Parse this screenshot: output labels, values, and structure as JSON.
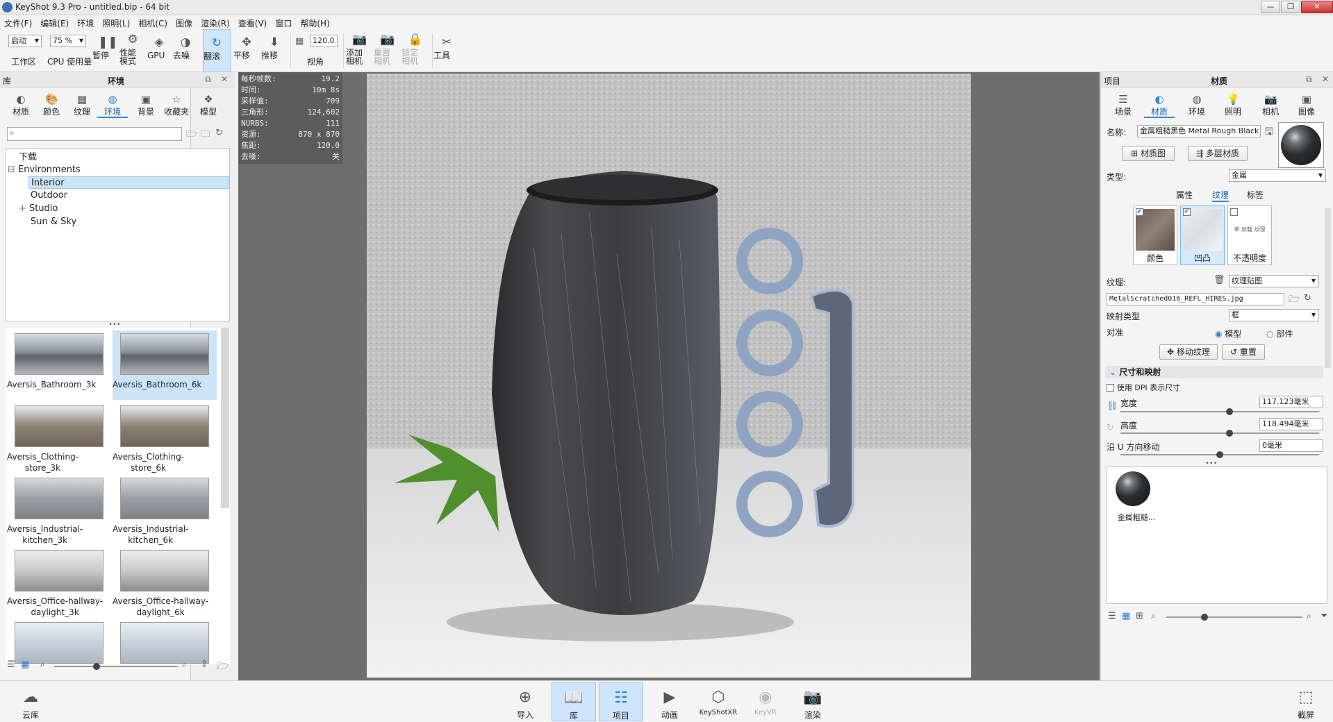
{
  "window": {
    "title": "KeyShot 9.3 Pro  - untitled.bip  - 64 bit"
  },
  "menu": [
    "文件(F)",
    "编辑(E)",
    "环境",
    "照明(L)",
    "相机(C)",
    "图像",
    "渲染(R)",
    "查看(V)",
    "窗口",
    "帮助(H)"
  ],
  "toolbar": {
    "workspace_value": "启动",
    "workspace_label": "工作区",
    "cpu_value": "75 %",
    "cpu_label": "CPU 使用量",
    "pause": "暂停",
    "perf_mode": "性能\n模式",
    "gpu": "GPU",
    "denoise": "去噪",
    "tumble": "翻滚",
    "pan": "平移",
    "dolly": "推移",
    "fov_value": "120.0",
    "fov_label": "视角",
    "add_camera": "添加\n相机",
    "reset_camera": "重置\n相机",
    "lock_camera": "锁定\n相机",
    "tools": "工具"
  },
  "library": {
    "header_left": "库",
    "header_title": "环境",
    "tabs": [
      "材质",
      "颜色",
      "纹理",
      "环境",
      "背景",
      "收藏夹",
      "模型"
    ],
    "active_tab": "环境",
    "tree": {
      "downloads": "下载",
      "root": "Environments",
      "children": [
        "Interior",
        "Outdoor",
        "Studio",
        "Sun & Sky"
      ],
      "selected": "Interior"
    },
    "thumbnails": [
      {
        "label": "Aversis_Bathroom_3k"
      },
      {
        "label": "Aversis_Bathroom_6k"
      },
      {
        "label": "Aversis_Clothing-\nstore_3k"
      },
      {
        "label": "Aversis_Clothing-\nstore_6k"
      },
      {
        "label": "Aversis_Industrial-\nkitchen_3k"
      },
      {
        "label": "Aversis_Industrial-\nkitchen_6k"
      },
      {
        "label": "Aversis_Office-hallway-\ndaylight_3k"
      },
      {
        "label": "Aversis_Office-hallway-\ndaylight_6k"
      },
      {
        "label": ""
      },
      {
        "label": ""
      }
    ],
    "selected_thumbnail": "Aversis_Bathroom_6k"
  },
  "hud": [
    {
      "k": "每秒帧数:",
      "v": "19.2"
    },
    {
      "k": "时间:",
      "v": "10m 8s"
    },
    {
      "k": "采样值:",
      "v": "709"
    },
    {
      "k": "三角形:",
      "v": "124,602"
    },
    {
      "k": "NURBS:",
      "v": "111"
    },
    {
      "k": "资源:",
      "v": "870 x 870"
    },
    {
      "k": "焦距:",
      "v": "120.0"
    },
    {
      "k": "去噪:",
      "v": "关"
    }
  ],
  "project": {
    "header_left": "项目",
    "header_title": "材质",
    "tabs": [
      "场景",
      "材质",
      "环境",
      "照明",
      "相机",
      "图像"
    ],
    "active_tab": "材质",
    "name_label": "名称:",
    "name_value": "金属粗糙黑色 Metal Rough Black",
    "material_graph": "材质图",
    "multilayer": "多层材质",
    "type_label": "类型:",
    "type_value": "金属",
    "subtabs": [
      "属性",
      "纹理",
      "标签"
    ],
    "active_subtab": "纹理",
    "tex_cards": [
      {
        "label": "颜色",
        "checked": true
      },
      {
        "label": "凹凸",
        "checked": true
      },
      {
        "label": "不透明度",
        "checked": false,
        "hint": "单 加载 纹理"
      }
    ],
    "texture_label": "纹理:",
    "texture_type": "纹理贴图",
    "texture_file": "MetalScratched016_REFL_HIRES.jpg",
    "mapping_label": "映射类型",
    "mapping_value": "框",
    "align_label": "对准",
    "align_model": "模型",
    "align_part": "部件",
    "move_texture": "移动纹理",
    "reset": "重置",
    "size_section": "尺寸和映射",
    "dpi_label": "使用 DPI 表示尺寸",
    "width_label": "宽度",
    "width_value": "117.123毫米",
    "width_slider": 0.55,
    "height_label": "高度",
    "height_value": "118.494毫米",
    "height_slider": 0.55,
    "u_label": "沿 U 方向移动",
    "u_value": "0毫米",
    "u_slider": 0.5,
    "swatch_label": "金属粗糙..."
  },
  "bottom": {
    "cloud": "云库",
    "import": "导入",
    "library": "库",
    "project": "项目",
    "animation": "动画",
    "keyshotxr": "KeyShotXR",
    "keyvr": "KeyVR",
    "render": "渲染",
    "screenshot": "截屏"
  }
}
